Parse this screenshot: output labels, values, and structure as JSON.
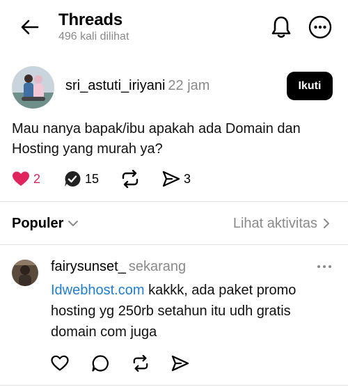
{
  "header": {
    "title": "Threads",
    "views": "496 kali dilihat"
  },
  "post": {
    "username": "sri_astuti_iriyani",
    "time": "22 jam",
    "follow_label": "Ikuti",
    "text": "Mau nanya bapak/ibu apakah ada Domain dan Hosting yang murah ya?",
    "likes": "2",
    "replies": "15",
    "shares": "3"
  },
  "sort": {
    "label": "Populer",
    "activity_link": "Lihat aktivitas"
  },
  "reply": {
    "username": "fairysunset_",
    "time": "sekarang",
    "link_text": "Idwebhost.com",
    "text": " kakkk, ada paket promo hosting yg 250rb setahun itu udh gratis domain com juga"
  },
  "colors": {
    "like_red": "#e0245e",
    "link_blue": "#1f7ed0",
    "muted": "#8a8a8a"
  }
}
